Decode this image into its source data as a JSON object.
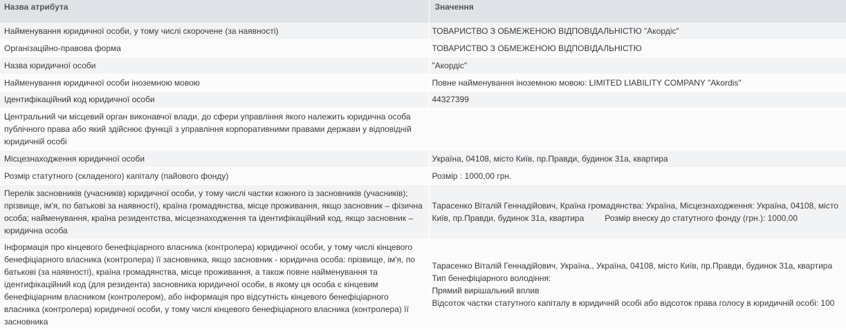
{
  "header": {
    "attr_col": "Назва атрибута",
    "value_col": "Значення"
  },
  "rows": [
    {
      "attr": "Найменування юридичної особи, у тому числі скорочене (за наявності)",
      "value": "ТОВАРИСТВО З ОБМЕЖЕНОЮ ВІДПОВІДАЛЬНІСТЮ \"Акордіс\""
    },
    {
      "attr": "Організаційно-правова форма",
      "value": "ТОВАРИСТВО З ОБМЕЖЕНОЮ ВІДПОВІДАЛЬНІСТЮ"
    },
    {
      "attr": "Назва юридичної особи",
      "value": "\"Акордіс\""
    },
    {
      "attr": "Найменування юридичної особи іноземною мовою",
      "value": "Повне найменування іноземною мовою: LIMITED LIABILITY COMPANY \"Akordis\""
    },
    {
      "attr": "Ідентифікаційний код юридичної особи",
      "value": "44327399"
    },
    {
      "attr": "Центральний чи місцевий орган виконавчої влади, до сфери управління якого належить юридична особа публічного права або який здійснює функції з управління корпоративними правами держави у відповідній юридичній особі",
      "value": ""
    },
    {
      "attr": "Місцезнаходження юридичної особи",
      "value": "Україна, 04108, місто Київ, пр.Правди, будинок 31а, квартира"
    },
    {
      "attr": "Розмір статутного (складеного) капіталу (пайового фонду)",
      "value": "Розмір : 1000,00 грн."
    },
    {
      "attr": "Перелік засновників (учасників) юридичної особи, у тому числі частки кожного із засновників (учасників); прізвище, ім'я, по батькові за наявності), країна громадянства, місце проживання, якщо засновник – фізична особа; найменування, країна резидентства, місцезнаходження та ідентифікаційний код, якщо засновник – юридична особа",
      "value_main": "Тарасенко Віталій Геннадійович, Країна громадянства: Україна, Місцезнаходження: Україна, 04108, місто Київ, пр.Правди, будинок 31а, квартира",
      "value_extra": "Розмір внеску до статутного фонду (грн.): 1000,00"
    },
    {
      "attr": "Інформація про кінцевого бенефіціарного власника (контролера) юридичної особи, у тому числі кінцевого бенефіціарного власника (контролера) її засновника, якщо засновник - юридична особа: прізвище, ім'я, по батькові (за наявності), країна громадянства, місце проживання, а також повне найменування та ідентифікаційний код (для резидента) засновника юридичної особи, в якому ця особа є кінцевим бенефіціарним власником (контролером), або інформація про відсутність кінцевого бенефіціарного власника (контролера) юридичної особи, у тому числі кінцевого бенефіціарного власника (контролера) її засновника",
      "value_lines": [
        "Тарасенко Віталій Геннадійович, Україна., Україна, 04108, місто Київ, пр.Правди, будинок 31а, квартира",
        "Тип бенефіціарного володіння:",
        "Прямий вирішальний вплив",
        "Відсоток частки статутного капіталу в юридичній особі або відсоток права голосу в юридичній особі: 100"
      ]
    }
  ]
}
